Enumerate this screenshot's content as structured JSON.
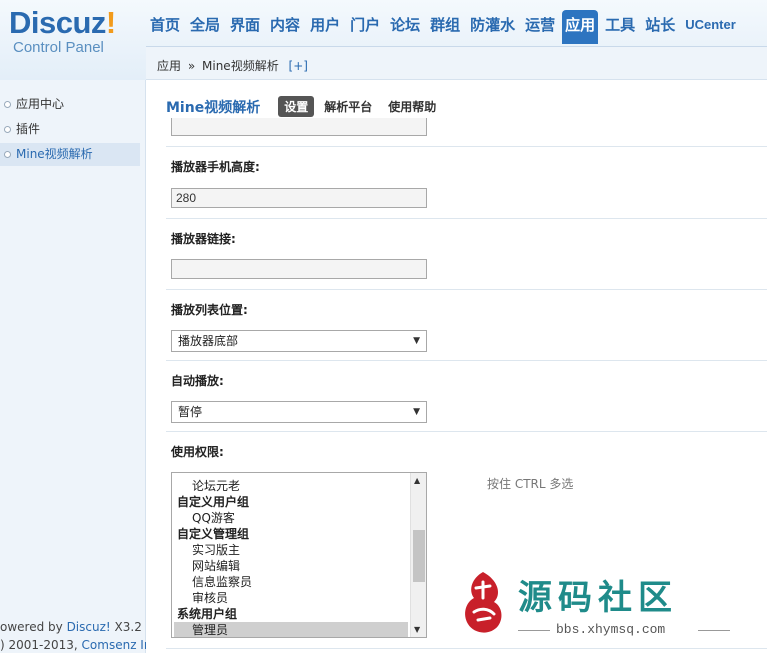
{
  "logo": {
    "main": "Discuz",
    "bang": "!",
    "sub": "Control Panel"
  },
  "topnav": [
    "首页",
    "全局",
    "界面",
    "内容",
    "用户",
    "门户",
    "论坛",
    "群组",
    "防灌水",
    "运营",
    "应用",
    "工具",
    "站长",
    "UCenter"
  ],
  "topnav_active": "应用",
  "breadcrumb": {
    "parent": "应用",
    "sep": "»",
    "current": "Mine视频解析",
    "plus": "[+]"
  },
  "sidebar": {
    "items": [
      "应用中心",
      "插件",
      "Mine视频解析"
    ],
    "footer": {
      "line1_prefix": "owered by ",
      "line1_link": "Discuz!",
      "line1_suffix": " X3.2",
      "line2_prefix": ") 2001-2013, ",
      "line2_link": "Comsenz Inc."
    }
  },
  "main": {
    "title": "Mine视频解析",
    "tabs": [
      "设置",
      "解析平台",
      "使用帮助"
    ],
    "fields": {
      "height_label": "播放器手机高度:",
      "height_value": "280",
      "link_label": "播放器链接:",
      "link_value": "",
      "list_pos_label": "播放列表位置:",
      "list_pos_value": "播放器底部",
      "autoplay_label": "自动播放:",
      "autoplay_value": "暂停",
      "perm_label": "使用权限:",
      "perm_hint": "按住 CTRL 多选"
    },
    "perm_options": [
      {
        "text": "论坛元老",
        "kind": "sub",
        "selected": false
      },
      {
        "text": "自定义用户组",
        "kind": "grp",
        "selected": false
      },
      {
        "text": "QQ游客",
        "kind": "sub",
        "selected": false
      },
      {
        "text": "自定义管理组",
        "kind": "grp",
        "selected": false
      },
      {
        "text": "实习版主",
        "kind": "sub",
        "selected": false
      },
      {
        "text": "网站编辑",
        "kind": "sub",
        "selected": false
      },
      {
        "text": "信息监察员",
        "kind": "sub",
        "selected": false
      },
      {
        "text": "审核员",
        "kind": "sub",
        "selected": false
      },
      {
        "text": "系统用户组",
        "kind": "grp",
        "selected": false
      },
      {
        "text": "管理员",
        "kind": "sub",
        "selected": true
      }
    ]
  },
  "watermark": {
    "title": "源码社区",
    "url": "bbs.xhymsq.com"
  },
  "colors": {
    "brand": "#2a6ab0",
    "accent": "#f29b1c",
    "active_tab": "#2d74c0",
    "watermark": "#1f8b8a",
    "seal": "#c8202a"
  }
}
